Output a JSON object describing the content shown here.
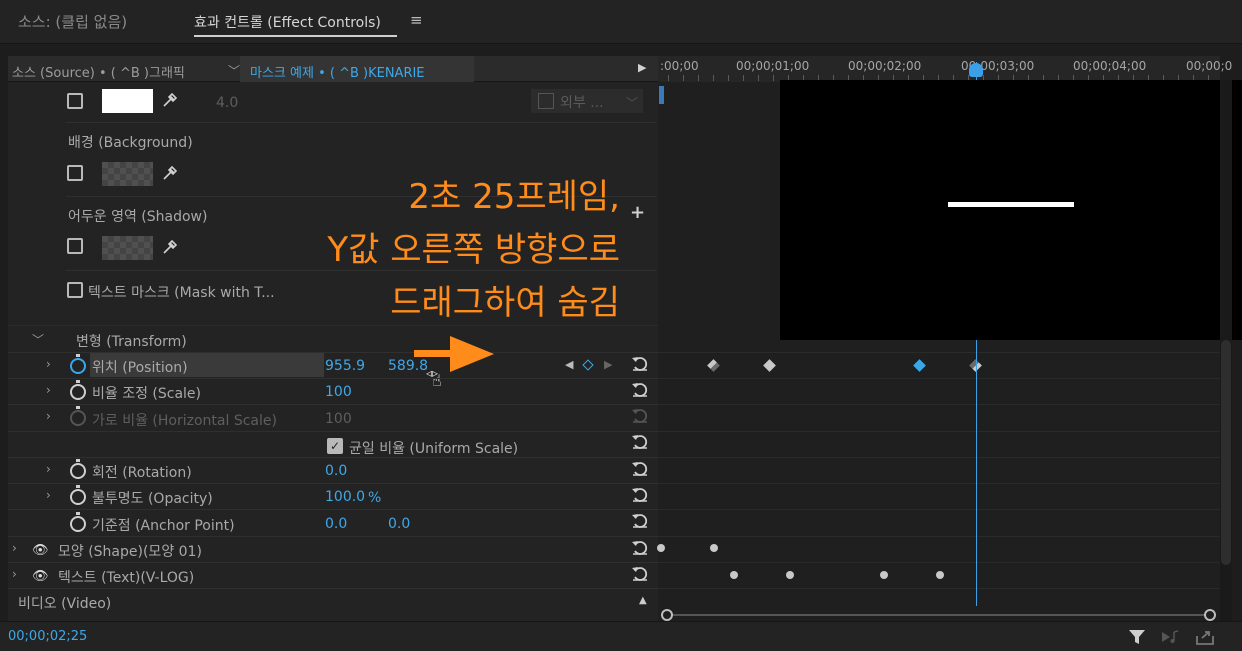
{
  "tabs": {
    "source_tab": "소스: (클립 없음)",
    "effect_tab": "효과 컨트롤 (Effect Controls)",
    "menu_icon": "≡"
  },
  "header": {
    "source_label": "소스 (Source) • ( ^B )그래픽",
    "clip_label": "마스크 예제 • ( ^B )KENARIE",
    "play_icon": "▶"
  },
  "ruler": {
    "labels": [
      ":00;00",
      "00;00;01;00",
      "00;00;02;00",
      "00;00;03;00",
      "00;00;04;00",
      "00;00;0"
    ]
  },
  "properties": {
    "stroke_width": "4.0",
    "stroke_position": "외부 ...",
    "background": "배경 (Background)",
    "shadow": "어두운 영역 (Shadow)",
    "text_mask": "텍스트 마스크 (Mask with T...",
    "transform": "변형 (Transform)",
    "position": {
      "label": "위치 (Position)",
      "x": "955.9",
      "y": "589.8"
    },
    "scale": {
      "label": "비율 조정 (Scale)",
      "value": "100"
    },
    "hscale": {
      "label": "가로 비율 (Horizontal Scale)",
      "value": "100"
    },
    "uniform": "균일 비율 (Uniform Scale)",
    "rotation": {
      "label": "회전 (Rotation)",
      "value": "0.0"
    },
    "opacity": {
      "label": "불투명도 (Opacity)",
      "value": "100.0",
      "unit": "%"
    },
    "anchor": {
      "label": "기준점 (Anchor Point)",
      "x": "0.0",
      "y": "0.0"
    }
  },
  "layers": {
    "shape": "모양 (Shape)(모양 01)",
    "text": "텍스트 (Text)(V-LOG)",
    "video": "비디오 (Video)"
  },
  "annotation": {
    "line1": "2초 25프레임,",
    "line2": "Y값 오른쪽 방향으로",
    "line3": "드래그하여 숨김"
  },
  "footer": {
    "timecode": "00;00;02;25"
  },
  "colors": {
    "accent_blue": "#3fa8e8",
    "annotation_orange": "#ff8c1a",
    "keyframe_selected": "#3aa8e8"
  }
}
